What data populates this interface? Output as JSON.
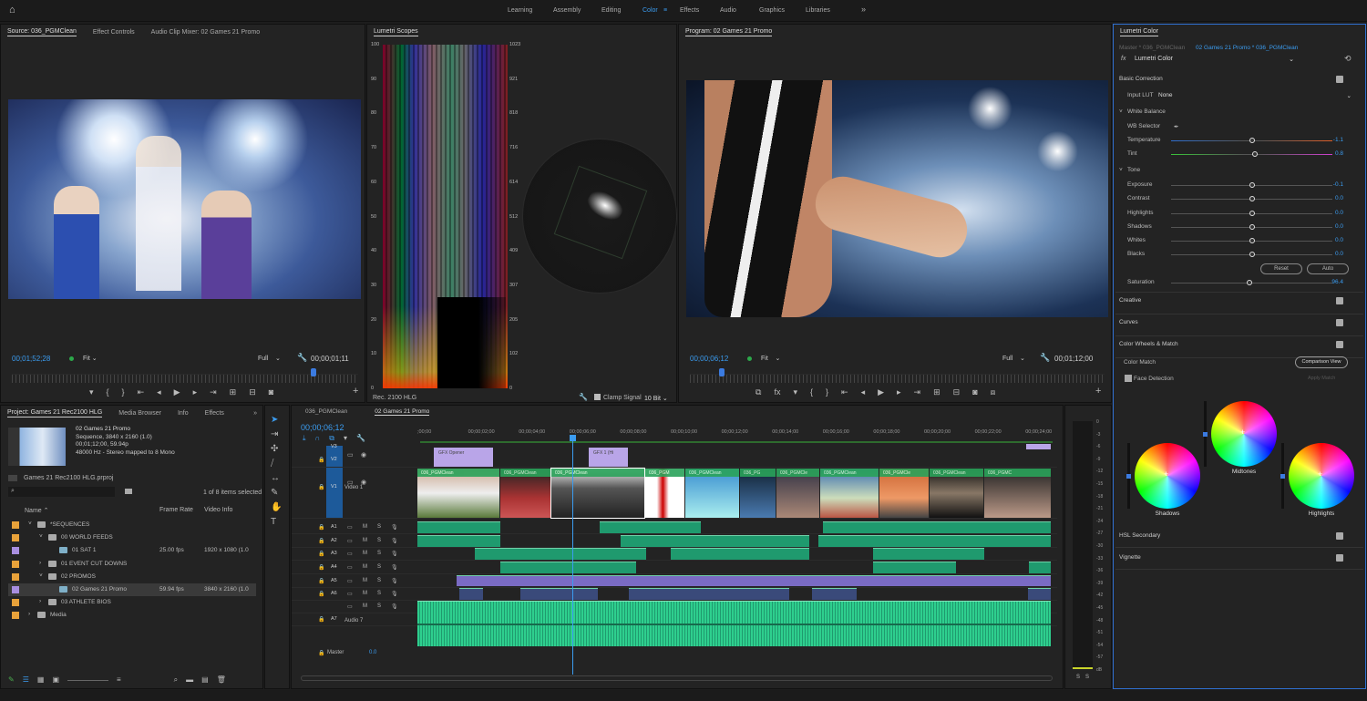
{
  "workspaces": {
    "items": [
      "Learning",
      "Assembly",
      "Editing",
      "Color",
      "Effects",
      "Audio",
      "Graphics",
      "Libraries"
    ],
    "active": "Color",
    "more": "»"
  },
  "source": {
    "tabs": [
      "Source: 036_PGMClean",
      "Effect Controls",
      "Audio Clip Mixer: 02 Games 21 Promo"
    ],
    "timecode": "00;01;52;28",
    "fit": "Fit",
    "quality": "Full",
    "duration": "00;00;01;11"
  },
  "scopes": {
    "title": "Lumetri Scopes",
    "left_ticks": [
      "100",
      "90",
      "80",
      "70",
      "60",
      "50",
      "40",
      "30",
      "20",
      "10",
      "0"
    ],
    "right_ticks": [
      "1023",
      "921",
      "818",
      "716",
      "614",
      "512",
      "409",
      "307",
      "205",
      "102",
      "0"
    ],
    "colorspace": "Rec. 2100 HLG",
    "clamp_label": "Clamp Signal",
    "clamp_checked": true,
    "bit_depth": "10 Bit"
  },
  "program": {
    "title": "Program: 02 Games 21 Promo",
    "timecode": "00;00;06;12",
    "fit": "Fit",
    "quality": "Full",
    "duration": "00;01;12;00"
  },
  "lumetri": {
    "title": "Lumetri Color",
    "master": "Master * 036_PGMClean",
    "clip": "02 Games 21 Promo * 036_PGMClean",
    "effect": "Lumetri Color",
    "basic": "Basic Correction",
    "input_lut_label": "Input LUT",
    "input_lut": "None",
    "white_balance": "White Balance",
    "wb_selector": "WB Selector",
    "sliders": [
      {
        "label": "Temperature",
        "value": "-1.1",
        "pos": 0.5
      },
      {
        "label": "Tint",
        "value": "0.8",
        "pos": 0.52
      },
      {
        "label": "Exposure",
        "value": "-0.1",
        "pos": 0.5
      },
      {
        "label": "Contrast",
        "value": "0.0",
        "pos": 0.5
      },
      {
        "label": "Highlights",
        "value": "0.0",
        "pos": 0.5
      },
      {
        "label": "Shadows",
        "value": "0.0",
        "pos": 0.5
      },
      {
        "label": "Whites",
        "value": "0.0",
        "pos": 0.5
      },
      {
        "label": "Blacks",
        "value": "0.0",
        "pos": 0.5
      }
    ],
    "tone": "Tone",
    "reset": "Reset",
    "auto": "Auto",
    "saturation_label": "Saturation",
    "saturation": "96.4",
    "sections": [
      "Creative",
      "Curves",
      "Color Wheels & Match"
    ],
    "color_match": "Color Match",
    "comparison_view": "Comparison View",
    "face_detection": "Face Detection",
    "apply_match": "Apply Match",
    "wheels": [
      "Shadows",
      "Midtones",
      "Highlights"
    ],
    "bottom_sections": [
      "HSL Secondary",
      "Vignette"
    ]
  },
  "project": {
    "tabs": [
      "Project: Games 21 Rec2100 HLG",
      "Media Browser",
      "Info",
      "Effects"
    ],
    "preview": [
      "02 Games 21 Promo",
      "Sequence, 3840 x 2160 (1.0)",
      "00;01;12;00, 59.94p",
      "48000 Hz - Stereo mapped to 8 Mono"
    ],
    "file": "Games 21 Rec2100 HLG.prproj",
    "search_placeholder": "",
    "selection": "1 of 8 items selected",
    "columns": [
      "Name",
      "Frame Rate",
      "Video Info"
    ],
    "items": [
      {
        "name": "*SEQUENCES",
        "rate": "",
        "info": "",
        "color": "#e8a23a",
        "indent": 0,
        "type": "folder",
        "open": true
      },
      {
        "name": "00 WORLD FEEDS",
        "rate": "",
        "info": "",
        "color": "#e8a23a",
        "indent": 1,
        "type": "folder",
        "open": true
      },
      {
        "name": "01 SAT 1",
        "rate": "25.00 fps",
        "info": "1920 x 1080 (1.0",
        "color": "#a88ee0",
        "indent": 2,
        "type": "seq"
      },
      {
        "name": "01 EVENT CUT DOWNS",
        "rate": "",
        "info": "",
        "color": "#e8a23a",
        "indent": 1,
        "type": "folder",
        "open": false
      },
      {
        "name": "02 PROMOS",
        "rate": "",
        "info": "",
        "color": "#e8a23a",
        "indent": 1,
        "type": "folder",
        "open": true
      },
      {
        "name": "02 Games 21 Promo",
        "rate": "59.94 fps",
        "info": "3840 x 2160 (1.0",
        "color": "#a88ee0",
        "indent": 2,
        "type": "seq",
        "selected": true
      },
      {
        "name": "03 ATHLETE BIOS",
        "rate": "",
        "info": "",
        "color": "#e8a23a",
        "indent": 1,
        "type": "folder",
        "open": false
      },
      {
        "name": "Media",
        "rate": "",
        "info": "",
        "color": "#e8a23a",
        "indent": 0,
        "type": "folder",
        "open": false
      }
    ]
  },
  "timeline": {
    "tabs": [
      "036_PGMClean",
      "02 Games 21 Promo"
    ],
    "timecode": "00;00;06;12",
    "ruler": [
      ";00;00",
      "00;00;02;00",
      "00;00;04;00",
      "00;00;06;00",
      "00;00;08;00",
      "00;00;10;00",
      "00;00;12;00",
      "00;00;14;00",
      "00;00;16;00",
      "00;00;18;00",
      "00;00;20;00",
      "00;00;22;00",
      "00;00;24;00"
    ],
    "video_tracks": [
      "V3",
      "V2",
      "V1"
    ],
    "video1_name": "Video 1",
    "audio_tracks": [
      "A1",
      "A2",
      "A3",
      "A4",
      "A5",
      "A6",
      "",
      "A7"
    ],
    "audio7_name": "Audio 7",
    "master": "Master",
    "master_value": "0.0",
    "gfx_clips": [
      "GFX Opener",
      "GFX 1 (Hi"
    ],
    "v1_clips": [
      "036_PGMClean",
      "036_PGMClean",
      "036_PGMClean",
      "036_PGM",
      "036_PGMClean",
      "036_PG",
      "036_PGMCle",
      "036_PGMClean",
      "036_PGMCle",
      "036_PGMClean",
      "036_PGMC"
    ]
  },
  "meter": {
    "ticks": [
      "0",
      "-3",
      "-6",
      "-9",
      "-12",
      "-15",
      "-18",
      "-21",
      "-24",
      "-27",
      "-30",
      "-33",
      "-36",
      "-39",
      "-42",
      "-45",
      "-48",
      "-51",
      "-54",
      "-57",
      "dB"
    ],
    "solo": [
      "S",
      "S"
    ]
  },
  "colors": {
    "accent": "#3b9cf0",
    "audio_clip": "#1f9a6e",
    "video_clip": "#2aa35a",
    "gfx_clip": "#b9a5e8",
    "a5_clip": "#7a6bc4"
  }
}
